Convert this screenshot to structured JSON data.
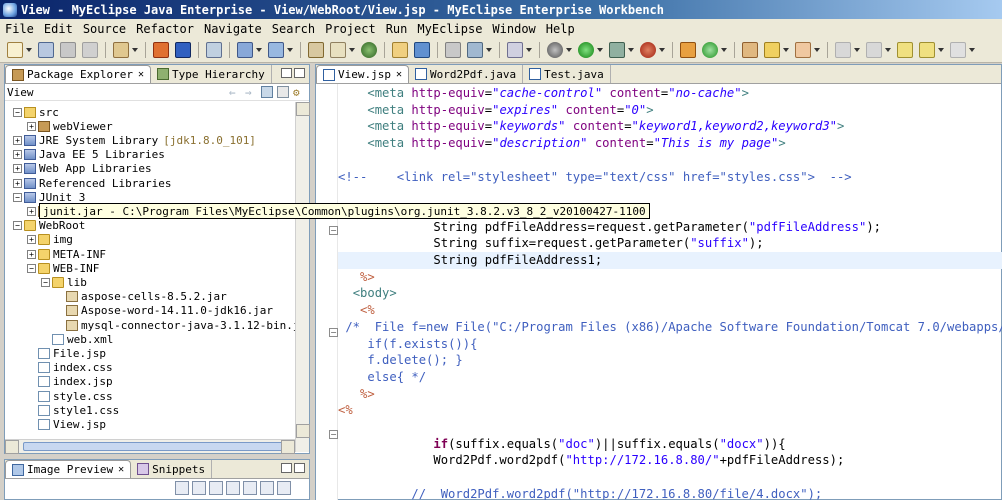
{
  "window": {
    "title": "View - MyEclipse Java Enterprise - View/WebRoot/View.jsp - MyEclipse Enterprise Workbench"
  },
  "menu": [
    "File",
    "Edit",
    "Source",
    "Refactor",
    "Navigate",
    "Search",
    "Project",
    "Run",
    "MyEclipse",
    "Window",
    "Help"
  ],
  "left_panel": {
    "tabs": [
      {
        "label": "Package Explorer",
        "active": true,
        "icon": "package-explorer-icon"
      },
      {
        "label": "Type Hierarchy",
        "active": false,
        "icon": "type-hierarchy-icon"
      }
    ],
    "view_label": "View",
    "tree": [
      {
        "label": "src",
        "icon": "source-folder-icon",
        "expanded": true
      },
      {
        "label": "webViewer",
        "icon": "package-icon",
        "expanded": false
      },
      {
        "label": "JRE System Library",
        "suffix": "[jdk1.8.0_101]",
        "icon": "library-icon"
      },
      {
        "label": "Java EE 5 Libraries",
        "icon": "library-icon"
      },
      {
        "label": "Web App Libraries",
        "icon": "library-icon"
      },
      {
        "label": "Referenced Libraries",
        "icon": "library-icon"
      },
      {
        "label": "JUnit 3",
        "icon": "library-icon",
        "expanded": true
      },
      {
        "label": "junit.jar",
        "icon": "jar-icon"
      },
      {
        "label": "WebRoot",
        "icon": "folder-icon",
        "expanded": true
      },
      {
        "label": "img",
        "icon": "folder-icon"
      },
      {
        "label": "META-INF",
        "icon": "folder-icon"
      },
      {
        "label": "WEB-INF",
        "icon": "folder-icon",
        "expanded": true
      },
      {
        "label": "lib",
        "icon": "folder-icon",
        "expanded": true
      },
      {
        "label": "aspose-cells-8.5.2.jar",
        "icon": "jar-icon"
      },
      {
        "label": "Aspose-word-14.11.0-jdk16.jar",
        "icon": "jar-icon"
      },
      {
        "label": "mysql-connector-java-3.1.12-bin.jar",
        "icon": "jar-icon"
      },
      {
        "label": "web.xml",
        "icon": "xml-file-icon"
      },
      {
        "label": "File.jsp",
        "icon": "jsp-file-icon"
      },
      {
        "label": "index.css",
        "icon": "css-file-icon"
      },
      {
        "label": "index.jsp",
        "icon": "jsp-file-icon"
      },
      {
        "label": "style.css",
        "icon": "css-file-icon"
      },
      {
        "label": "style1.css",
        "icon": "css-file-icon"
      },
      {
        "label": "View.jsp",
        "icon": "jsp-file-icon"
      }
    ],
    "tooltip": "junit.jar - C:\\Program Files\\MyEclipse\\Common\\plugins\\org.junit_3.8.2.v3_8_2_v20100427-1100"
  },
  "bottom_panel": {
    "tabs": [
      {
        "label": "Image Preview",
        "active": true
      },
      {
        "label": "Snippets",
        "active": false
      }
    ]
  },
  "editor": {
    "tabs": [
      {
        "label": "View.jsp",
        "active": true
      },
      {
        "label": "Word2Pdf.java",
        "active": false
      },
      {
        "label": "Test.java",
        "active": false
      }
    ],
    "lines": [
      {
        "indent": "    ",
        "parts": [
          [
            "tag",
            "<meta "
          ],
          [
            "attr",
            "http-equiv"
          ],
          [
            "plain",
            "="
          ],
          [
            "val",
            "\"cache-control\""
          ],
          [
            "plain",
            " "
          ],
          [
            "attr",
            "content"
          ],
          [
            "plain",
            "="
          ],
          [
            "val",
            "\"no-cache\""
          ],
          [
            "tag",
            ">"
          ]
        ]
      },
      {
        "indent": "    ",
        "parts": [
          [
            "tag",
            "<meta "
          ],
          [
            "attr",
            "http-equiv"
          ],
          [
            "plain",
            "="
          ],
          [
            "val",
            "\"expires\""
          ],
          [
            "plain",
            " "
          ],
          [
            "attr",
            "content"
          ],
          [
            "plain",
            "="
          ],
          [
            "val",
            "\"0\""
          ],
          [
            "tag",
            ">"
          ]
        ]
      },
      {
        "indent": "    ",
        "parts": [
          [
            "tag",
            "<meta "
          ],
          [
            "attr",
            "http-equiv"
          ],
          [
            "plain",
            "="
          ],
          [
            "val",
            "\"keywords\""
          ],
          [
            "plain",
            " "
          ],
          [
            "attr",
            "content"
          ],
          [
            "plain",
            "="
          ],
          [
            "val",
            "\"keyword1,keyword2,keyword3\""
          ],
          [
            "tag",
            ">"
          ]
        ]
      },
      {
        "indent": "    ",
        "parts": [
          [
            "tag",
            "<meta "
          ],
          [
            "attr",
            "http-equiv"
          ],
          [
            "plain",
            "="
          ],
          [
            "val",
            "\"description\""
          ],
          [
            "plain",
            " "
          ],
          [
            "attr",
            "content"
          ],
          [
            "plain",
            "="
          ],
          [
            "val",
            "\"This is my page\""
          ],
          [
            "tag",
            ">"
          ]
        ]
      },
      {
        "indent": "",
        "parts": []
      },
      {
        "indent": "",
        "parts": [
          [
            "cmt",
            "<!--    <link rel=\"stylesheet\" type=\"text/css\" href=\"styles.css\">  -->"
          ]
        ]
      },
      {
        "indent": "",
        "parts": []
      },
      {
        "indent": "  ",
        "parts": [
          [
            "jsp",
            "<%"
          ]
        ]
      },
      {
        "indent": "             ",
        "parts": [
          [
            "plain",
            "String pdfFileAddress=request.getParameter("
          ],
          [
            "str",
            "\"pdfFileAddress\""
          ],
          [
            "plain",
            ");"
          ]
        ]
      },
      {
        "indent": "             ",
        "parts": [
          [
            "plain",
            "String suffix=request.getParameter("
          ],
          [
            "str",
            "\"suffix\""
          ],
          [
            "plain",
            ");"
          ]
        ]
      },
      {
        "indent": "             ",
        "parts": [
          [
            "plain",
            "String pdfFileAddress1;"
          ]
        ],
        "current": true
      },
      {
        "indent": "   ",
        "parts": [
          [
            "jsp",
            "%>"
          ]
        ]
      },
      {
        "indent": "  ",
        "parts": [
          [
            "tag",
            "<body>"
          ]
        ]
      },
      {
        "indent": "   ",
        "parts": [
          [
            "jsp",
            "<%"
          ]
        ]
      },
      {
        "indent": " ",
        "parts": [
          [
            "cmt",
            "/*  File f=new File(\"C:/Program Files (x86)/Apache Software Foundation/Tomcat 7.0/webapps/"
          ]
        ]
      },
      {
        "indent": "    ",
        "parts": [
          [
            "cmt",
            "if(f.exists()){"
          ]
        ]
      },
      {
        "indent": "    ",
        "parts": [
          [
            "cmt",
            "f.delete(); }"
          ]
        ]
      },
      {
        "indent": "    ",
        "parts": [
          [
            "cmt",
            "else{ */"
          ]
        ]
      },
      {
        "indent": "   ",
        "parts": [
          [
            "jsp",
            "%>"
          ]
        ]
      },
      {
        "indent": "",
        "parts": [
          [
            "jsp",
            "<%"
          ]
        ]
      },
      {
        "indent": "",
        "parts": []
      },
      {
        "indent": "             ",
        "parts": [
          [
            "kw",
            "if"
          ],
          [
            "plain",
            "(suffix.equals("
          ],
          [
            "str",
            "\"doc\""
          ],
          [
            "plain",
            ")||suffix.equals("
          ],
          [
            "str",
            "\"docx\""
          ],
          [
            "plain",
            "))"
          ],
          [
            "plain",
            "{"
          ]
        ]
      },
      {
        "indent": "             ",
        "parts": [
          [
            "plain",
            "Word2Pdf.word2pdf("
          ],
          [
            "str",
            "\"http://172.16.8.80/\""
          ],
          [
            "plain",
            "+pdfFileAddress);"
          ]
        ]
      },
      {
        "indent": "",
        "parts": []
      },
      {
        "indent": "          ",
        "parts": [
          [
            "cmt",
            "//  Word2Pdf.word2pdf(\"http://172.16.8.80/file/4.docx\");"
          ]
        ]
      }
    ]
  }
}
